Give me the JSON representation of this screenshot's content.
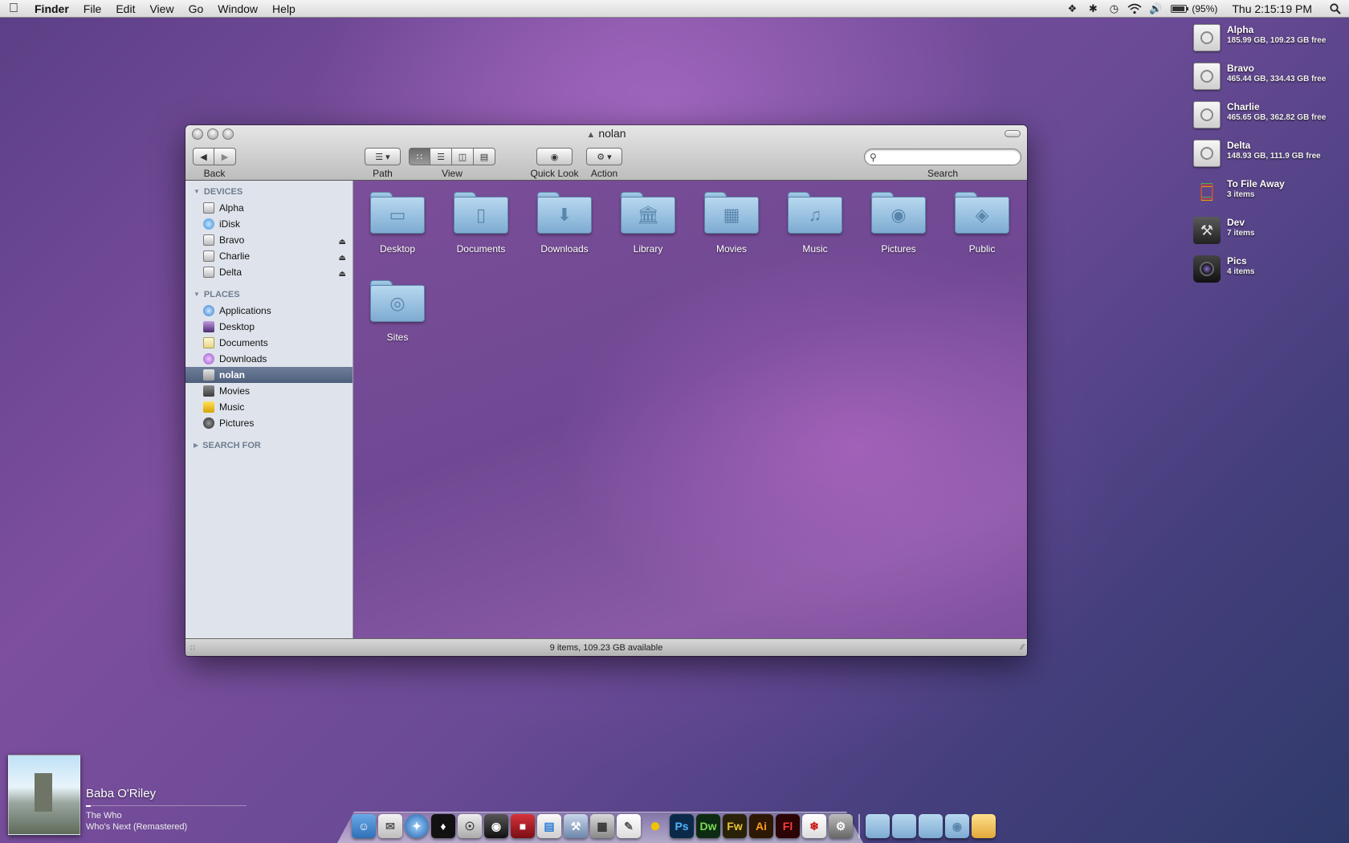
{
  "menubar": {
    "apple": "",
    "items": [
      "Finder",
      "File",
      "Edit",
      "View",
      "Go",
      "Window",
      "Help"
    ],
    "battery_percent_text": "(95%)",
    "battery_level": 0.95,
    "clock": "Thu 2:15:19 PM"
  },
  "desktop": {
    "items": [
      {
        "name": "Alpha",
        "info": "185.99 GB, 109.23 GB free",
        "icon": "hard-drive-icon"
      },
      {
        "name": "Bravo",
        "info": "465.44 GB, 334.43 GB free",
        "icon": "hard-drive-icon"
      },
      {
        "name": "Charlie",
        "info": "465.65 GB, 362.82 GB free",
        "icon": "hard-drive-icon"
      },
      {
        "name": "Delta",
        "info": "148.93 GB, 111.9 GB free",
        "icon": "hard-drive-icon"
      },
      {
        "name": "To File Away",
        "info": "3 items",
        "icon": "apple-logo-icon"
      },
      {
        "name": "Dev",
        "info": "7 items",
        "icon": "tools-icon"
      },
      {
        "name": "Pics",
        "info": "4 items",
        "icon": "camera-icon"
      }
    ]
  },
  "window": {
    "title": "nolan",
    "toolbar": {
      "back_label": "Back",
      "path_label": "Path",
      "view_label": "View",
      "quicklook_label": "Quick Look",
      "action_label": "Action",
      "search_label": "Search",
      "search_value": ""
    },
    "sidebar": {
      "devices_header": "DEVICES",
      "devices": [
        {
          "label": "Alpha",
          "eject": false
        },
        {
          "label": "iDisk",
          "eject": false
        },
        {
          "label": "Bravo",
          "eject": true
        },
        {
          "label": "Charlie",
          "eject": true
        },
        {
          "label": "Delta",
          "eject": true
        }
      ],
      "places_header": "PLACES",
      "places": [
        {
          "label": "Applications"
        },
        {
          "label": "Desktop"
        },
        {
          "label": "Documents"
        },
        {
          "label": "Downloads"
        },
        {
          "label": "nolan",
          "selected": true
        },
        {
          "label": "Movies"
        },
        {
          "label": "Music"
        },
        {
          "label": "Pictures"
        }
      ],
      "search_header": "SEARCH FOR"
    },
    "folders": [
      "Desktop",
      "Documents",
      "Downloads",
      "Library",
      "Movies",
      "Music",
      "Pictures",
      "Public",
      "Sites"
    ],
    "status": "9 items, 109.23 GB available"
  },
  "now_playing": {
    "title": "Baba O'Riley",
    "artist": "The Who",
    "album": "Who's Next (Remastered)",
    "progress": 0.03
  },
  "dock": {
    "icons": [
      "finder-icon",
      "mail-icon",
      "safari-icon",
      "tuxedo-icon",
      "headphones-icon",
      "camera-icon",
      "photo-booth-icon",
      "charts-icon",
      "xcode-icon",
      "calculator-icon",
      "textedit-icon",
      "adium-icon",
      "Ps",
      "Dw",
      "Fw",
      "Ai",
      "Fl",
      "acrobat-icon",
      "system-preferences-icon",
      "applications-folder-icon",
      "documents-folder-icon",
      "downloads-folder-icon",
      "home-folder-icon",
      "stack-icon"
    ]
  },
  "colors": {
    "sidebar_header": "#6d7c8f",
    "sidebar_selected": "#4e5f7c",
    "folder_blue": "#7eabd2"
  }
}
